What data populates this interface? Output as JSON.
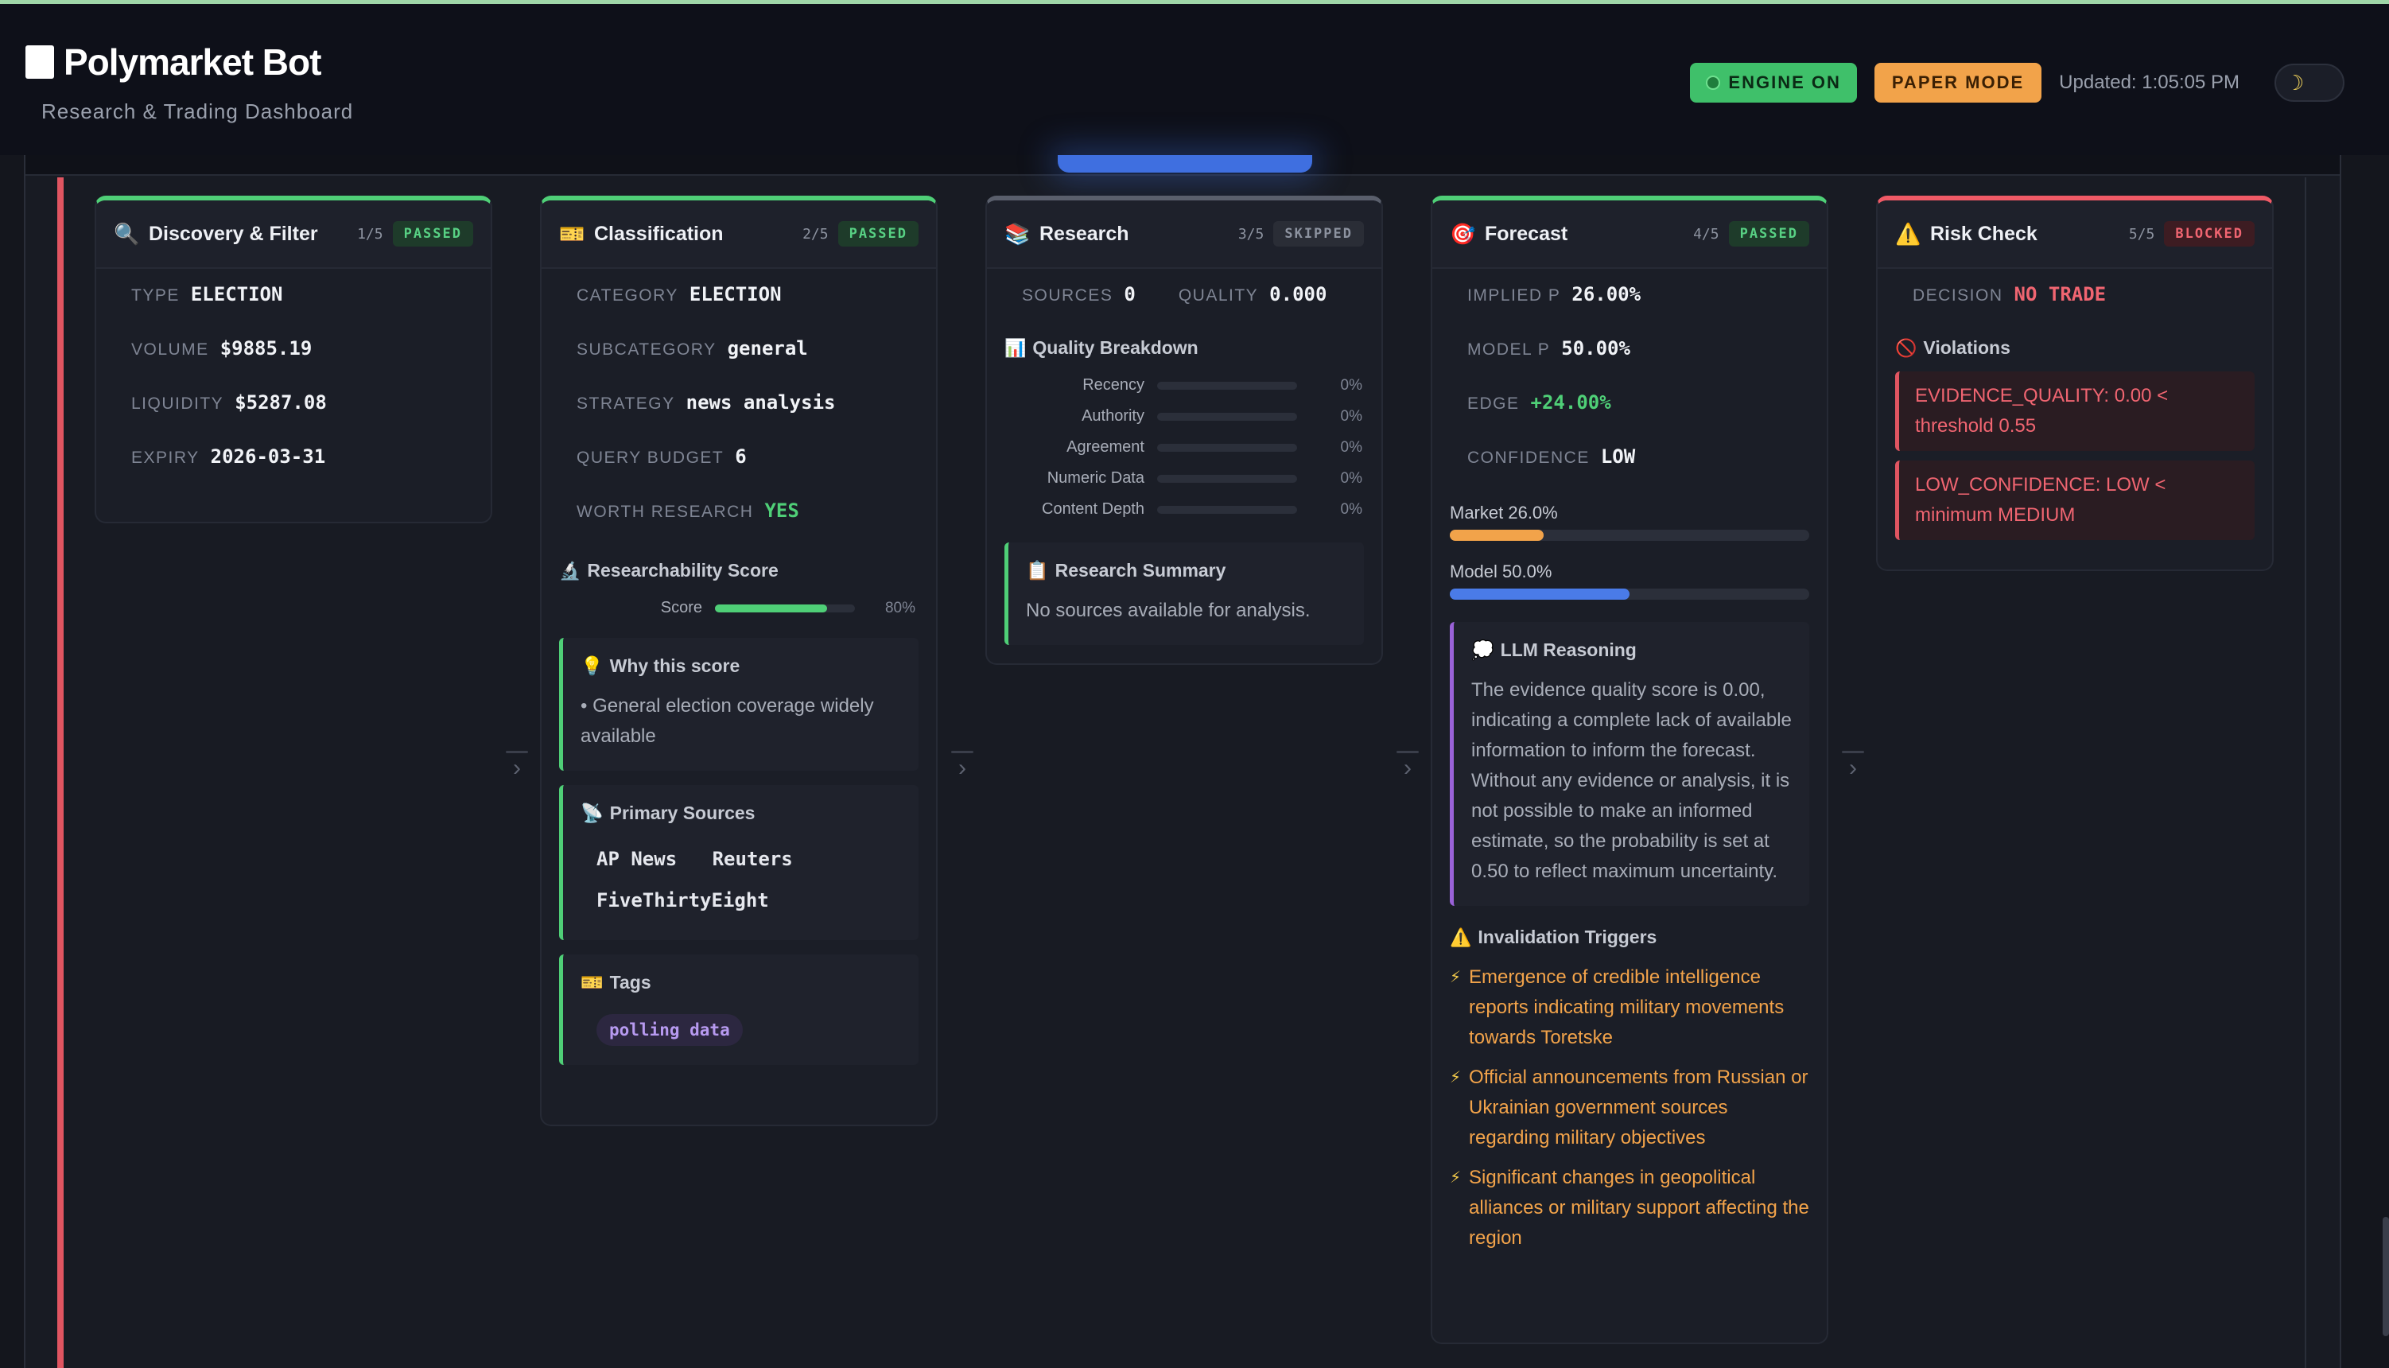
{
  "header": {
    "title": "Polymarket Bot",
    "subtitle": "Research & Trading Dashboard",
    "engine_label": "ENGINE ON",
    "mode_label": "PAPER MODE",
    "updated": "Updated: 1:05:05 PM"
  },
  "colors": {
    "passed": "#4fcf77",
    "skipped": "#5a5f6c",
    "blocked": "#f05a66",
    "accent_blue": "#3f6fe0",
    "warn": "#f2a34a"
  },
  "stages": {
    "discovery": {
      "icon": "🔍",
      "title": "Discovery & Filter",
      "step": "1/5",
      "status": "PASSED",
      "fields": [
        {
          "k": "TYPE",
          "v": "ELECTION"
        },
        {
          "k": "VOLUME",
          "v": "$9885.19"
        },
        {
          "k": "LIQUIDITY",
          "v": "$5287.08"
        },
        {
          "k": "EXPIRY",
          "v": "2026-03-31"
        }
      ]
    },
    "classification": {
      "icon": "🎫",
      "title": "Classification",
      "step": "2/5",
      "status": "PASSED",
      "fields": [
        {
          "k": "CATEGORY",
          "v": "ELECTION"
        },
        {
          "k": "SUBCATEGORY",
          "v": "general"
        },
        {
          "k": "STRATEGY",
          "v": "news analysis"
        },
        {
          "k": "QUERY BUDGET",
          "v": "6"
        },
        {
          "k": "WORTH RESEARCH",
          "v": "YES"
        }
      ],
      "score_title": "Researchability Score",
      "score_icon": "🔬",
      "score_label": "Score",
      "score_value": "80%",
      "score_fraction": 0.8,
      "why_title": "Why this score",
      "why_icon": "💡",
      "why_text": "• General election coverage widely available",
      "sources_title": "Primary Sources",
      "sources_icon": "📡",
      "sources": [
        "AP News",
        "Reuters",
        "FiveThirtyEight"
      ],
      "tags_title": "Tags",
      "tags_icon": "🎫",
      "tags": [
        "polling data"
      ]
    },
    "research": {
      "icon": "📚",
      "title": "Research",
      "step": "3/5",
      "status": "SKIPPED",
      "sources_k": "SOURCES",
      "sources_v": "0",
      "quality_k": "QUALITY",
      "quality_v": "0.000",
      "breakdown_title": "Quality Breakdown",
      "breakdown_icon": "📊",
      "breakdown": [
        {
          "label": "Recency",
          "value": "0%"
        },
        {
          "label": "Authority",
          "value": "0%"
        },
        {
          "label": "Agreement",
          "value": "0%"
        },
        {
          "label": "Numeric Data",
          "value": "0%"
        },
        {
          "label": "Content Depth",
          "value": "0%"
        }
      ],
      "summary_title": "Research Summary",
      "summary_icon": "📋",
      "summary_text": "No sources available for analysis."
    },
    "forecast": {
      "icon": "🎯",
      "title": "Forecast",
      "step": "4/5",
      "status": "PASSED",
      "fields": [
        {
          "k": "IMPLIED P",
          "v": "26.00%"
        },
        {
          "k": "MODEL P",
          "v": "50.00%"
        },
        {
          "k": "EDGE",
          "v": "+24.00%"
        },
        {
          "k": "CONFIDENCE",
          "v": "LOW"
        }
      ],
      "market_label": "Market 26.0%",
      "market_fraction": 0.26,
      "model_label": "Model 50.0%",
      "model_fraction": 0.5,
      "reasoning_title": "LLM Reasoning",
      "reasoning_icon": "💭",
      "reasoning_text": "The evidence quality score is 0.00, indicating a complete lack of available information to inform the forecast. Without any evidence or analysis, it is not possible to make an informed estimate, so the probability is set at 0.50 to reflect maximum uncertainty.",
      "triggers_title": "Invalidation Triggers",
      "triggers_icon": "⚠️",
      "triggers": [
        "Emergence of credible intelligence reports indicating military movements towards Toretske",
        "Official announcements from Russian or Ukrainian government sources regarding military objectives",
        "Significant changes in geopolitical alliances or military support affecting the region"
      ]
    },
    "risk": {
      "icon": "⚠️",
      "title": "Risk Check",
      "step": "5/5",
      "status": "BLOCKED",
      "decision_k": "DECISION",
      "decision_v": "NO TRADE",
      "violations_title": "Violations",
      "violations_icon": "🚫",
      "violations": [
        "EVIDENCE_QUALITY: 0.00 < threshold 0.55",
        "LOW_CONFIDENCE: LOW < minimum MEDIUM"
      ]
    }
  }
}
